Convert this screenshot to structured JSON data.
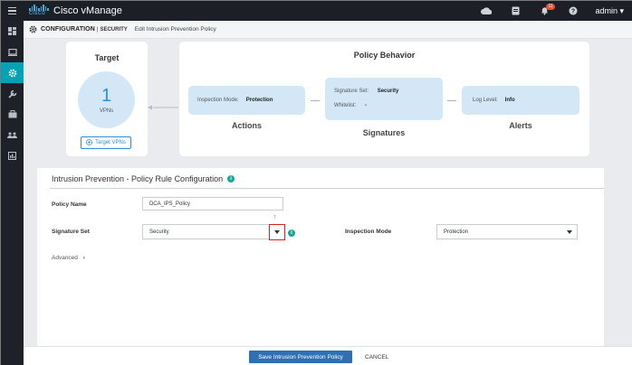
{
  "header": {
    "app_title": "Cisco vManage",
    "logo_text": "CISCO",
    "notification_count": "11",
    "user": "admin"
  },
  "breadcrumb": {
    "section": "CONFIGURATION",
    "separator": "|",
    "subsection": "SECURITY",
    "page": "Edit Intrusion Prevention Policy"
  },
  "target": {
    "title": "Target",
    "vpn_count": "1",
    "vpn_label": "VPNs",
    "button_label": "Target VPNs"
  },
  "policy_behavior": {
    "title": "Policy Behavior",
    "actions": {
      "field": "Inspection Mode:",
      "value": "Protection",
      "label": "Actions"
    },
    "signatures": {
      "set_field": "Signature Set:",
      "set_value": "Security",
      "whitelist_field": "Whitelist:",
      "whitelist_value": "-",
      "label": "Signatures"
    },
    "alerts": {
      "field": "Log Level:",
      "value": "Info",
      "label": "Alerts"
    }
  },
  "form": {
    "title": "Intrusion Prevention - Policy Rule Configuration",
    "policy_name_label": "Policy Name",
    "policy_name_value": "DCA_IPS_Policy",
    "signature_set_label": "Signature Set",
    "signature_set_value": "Security",
    "inspection_mode_label": "Inspection Mode",
    "inspection_mode_value": "Protection",
    "advanced_label": "Advanced"
  },
  "footer": {
    "save_label": "Save Intrusion Prevention Policy",
    "cancel_label": "CANCEL"
  },
  "colors": {
    "accent": "#00a3b4",
    "primary_button": "#2f6fb3",
    "highlight": "#e0201c",
    "pill_bg": "#d4e7f7"
  }
}
